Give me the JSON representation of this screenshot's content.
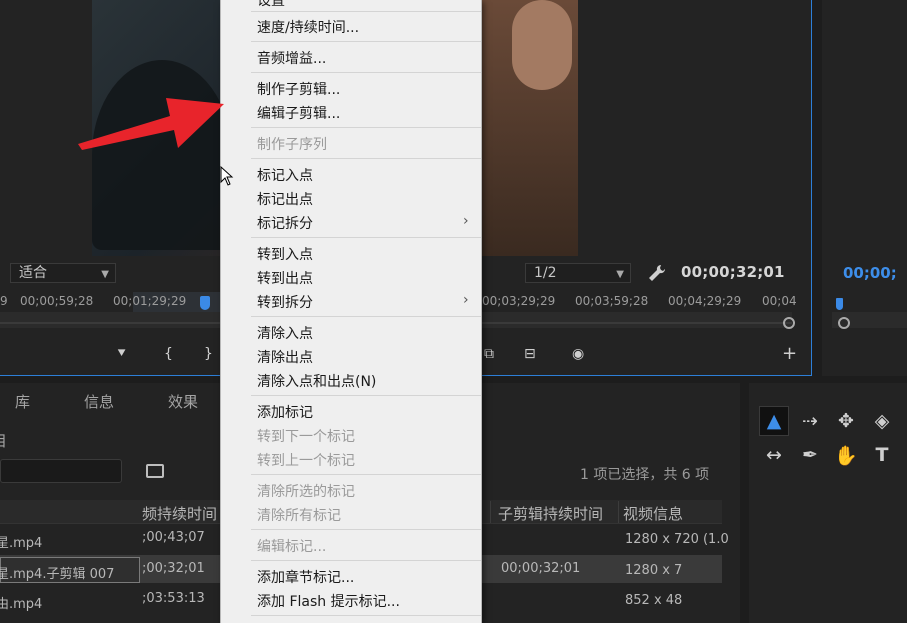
{
  "source_monitor": {
    "fit_dropdown": "适合",
    "quality_dropdown": "1/2",
    "timecode": "00;00;32;01",
    "ruler_labels": [
      "9",
      "00;00;59;28",
      "00;01;29;29",
      "00;03;29;29",
      "00;03;59;28",
      "00;04;29;29",
      "00;04"
    ],
    "playhead_fraction": 0.26
  },
  "program_monitor": {
    "timecode": "00;00;"
  },
  "project_panel": {
    "tabs": [
      "库",
      "信息",
      "效果"
    ],
    "partial_tab": "目",
    "selection_status": "1 项已选择，共 6 项",
    "columns": [
      "频持续时间",
      "子剪辑持续时间",
      "视频信息"
    ],
    "rows": [
      {
        "name": "星.mp4",
        "duration": ";00;43;07",
        "sub_duration": "",
        "video_info": "1280 x 720 (1.0"
      },
      {
        "name": "星.mp4.子剪辑 007",
        "duration": ";00;32;01",
        "sub_duration": "00;00;32;01",
        "video_info": "1280 x 7"
      },
      {
        "name": "由.mp4",
        "duration": ";03:53:13",
        "sub_duration": "",
        "video_info": "852 x 48"
      }
    ]
  },
  "tools": [
    "selection-tool",
    "track-select-tool",
    "ripple-edit-tool",
    "razor-tool",
    "slip-tool",
    "pen-tool",
    "hand-tool",
    "type-tool"
  ],
  "context_menu": {
    "top_partial": "设置",
    "items": [
      {
        "label": "速度/持续时间...",
        "enabled": true
      },
      {
        "label": "音频增益...",
        "enabled": true
      },
      {
        "label": "制作子剪辑...",
        "enabled": true
      },
      {
        "label": "编辑子剪辑...",
        "enabled": true
      },
      {
        "label": "制作子序列",
        "enabled": false
      },
      {
        "label": "标记入点",
        "enabled": true
      },
      {
        "label": "标记出点",
        "enabled": true
      },
      {
        "label": "标记拆分",
        "enabled": true,
        "submenu": true
      },
      {
        "label": "转到入点",
        "enabled": true
      },
      {
        "label": "转到出点",
        "enabled": true
      },
      {
        "label": "转到拆分",
        "enabled": true,
        "submenu": true
      },
      {
        "label": "清除入点",
        "enabled": true
      },
      {
        "label": "清除出点",
        "enabled": true
      },
      {
        "label": "清除入点和出点(N)",
        "enabled": true
      },
      {
        "label": "添加标记",
        "enabled": true
      },
      {
        "label": "转到下一个标记",
        "enabled": false
      },
      {
        "label": "转到上一个标记",
        "enabled": false
      },
      {
        "label": "清除所选的标记",
        "enabled": false
      },
      {
        "label": "清除所有标记",
        "enabled": false
      },
      {
        "label": "编辑标记...",
        "enabled": false
      },
      {
        "label": "添加章节标记...",
        "enabled": true
      },
      {
        "label": "添加 Flash 提示标记...",
        "enabled": true
      }
    ],
    "submenu_arrow": "›"
  },
  "annotation": {
    "arrow_color": "#e8242b"
  },
  "colors": {
    "accent_blue": "#3d8eea",
    "menu_bg": "#efefef",
    "panel_bg": "#232323"
  }
}
